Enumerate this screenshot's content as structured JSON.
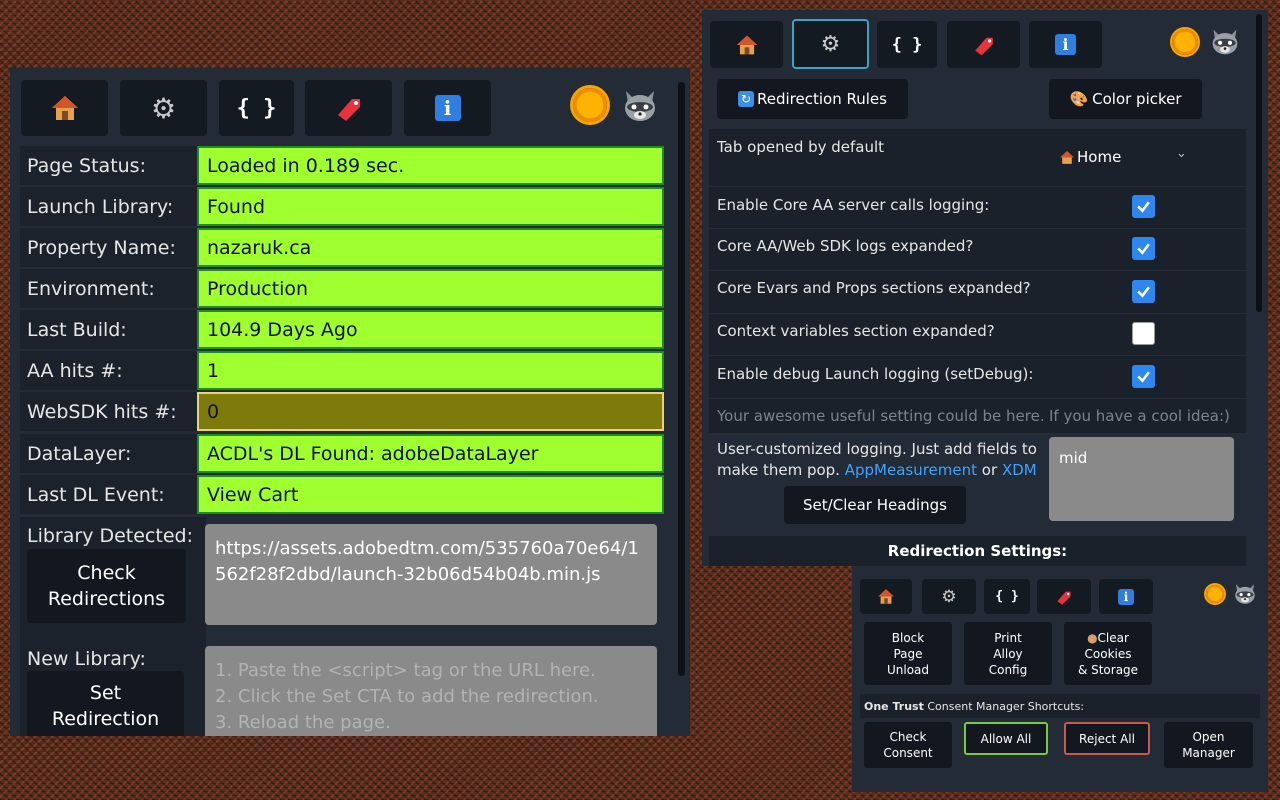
{
  "panel_main": {
    "rows": [
      {
        "label": "Page Status:",
        "value": "Loaded in 0.189 sec."
      },
      {
        "label": "Launch Library:",
        "value": "Found"
      },
      {
        "label": "Property Name:",
        "value": "nazaruk.ca"
      },
      {
        "label": "Environment:",
        "value": "Production"
      },
      {
        "label": "Last Build:",
        "value": "104.9 Days Ago"
      },
      {
        "label": "AA hits #:",
        "value": "1"
      },
      {
        "label": "WebSDK hits #:",
        "value": "0"
      },
      {
        "label": "DataLayer:",
        "value": "ACDL's DL Found: adobeDataLayer"
      },
      {
        "label": "Last DL Event:",
        "value": "View Cart"
      }
    ],
    "library_detected_label": "Library Detected:",
    "check_redirections_line1": "Check",
    "check_redirections_line2": "Redirections",
    "library_url": "https://assets.adobedtm.com/535760a70e64/1562f28f2dbd/launch-32b06d54b04b.min.js",
    "new_library_label": "New Library:",
    "set_redirection_line1": "Set",
    "set_redirection_line2": "Redirection",
    "new_library_placeholder": [
      "1. Paste the <script> tag or the URL here.",
      "2. Click the Set CTA to add the redirection.",
      "3. Reload the page."
    ]
  },
  "panel_settings": {
    "redirection_rules": "Redirection Rules",
    "color_picker": "Color picker",
    "tab_default_label": "Tab opened by default",
    "tab_default_value": "Home",
    "settings": [
      {
        "label": "Enable Core AA server calls logging:",
        "checked": true
      },
      {
        "label": "Core AA/Web SDK logs expanded?",
        "checked": true
      },
      {
        "label": "Core Evars and Props sections expanded?",
        "checked": true
      },
      {
        "label": "Context variables section expanded?",
        "checked": false
      },
      {
        "label": "Enable debug Launch logging (setDebug):",
        "checked": true
      }
    ],
    "awesome_text": "Your awesome useful setting could be here.",
    "cool_idea_text": "If you have a cool idea:)",
    "custom_logging_text": "User-customized logging. Just add fields to make them pop.",
    "link_appmeasurement": "AppMeasurement",
    "or_text": "or",
    "link_xdm": "XDM",
    "custom_field_value": "mid",
    "set_clear_headings": "Set/Clear Headings",
    "redirection_settings_title": "Redirection Settings:"
  },
  "panel_tools": {
    "block_page_unload": [
      "Block",
      "Page",
      "Unload"
    ],
    "print_alloy_config": [
      "Print",
      "Alloy",
      "Config"
    ],
    "clear_cookies": [
      "Clear",
      "Cookies",
      "& Storage"
    ],
    "consent_brand": "One Trust",
    "consent_rest": " Consent Manager Shortcuts:",
    "check_consent": [
      "Check",
      "Consent"
    ],
    "allow_all": "Allow All",
    "reject_all": "Reject All",
    "open_manager": [
      "Open",
      "Manager"
    ]
  },
  "colors": {
    "status_ok": "#a0ff2e",
    "status_warn": "#7e7a0c",
    "panel_bg": "#232b37",
    "accent": "#3aa3c8",
    "link": "#3ea3ff"
  },
  "icons": {
    "tabs": [
      "home-icon",
      "gear-icon",
      "braces-icon",
      "tag-icon",
      "info-icon"
    ],
    "corner": [
      "sun-icon",
      "raccoon-icon"
    ]
  }
}
